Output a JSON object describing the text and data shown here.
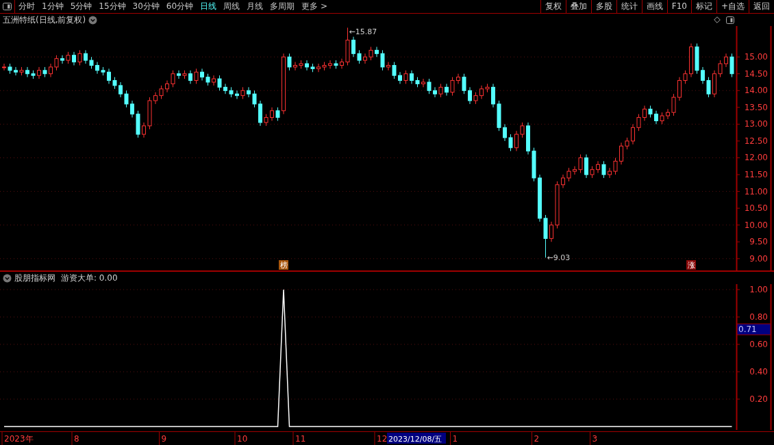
{
  "toolbar": {
    "periods": [
      {
        "label": "分时",
        "selected": false
      },
      {
        "label": "1分钟",
        "selected": false
      },
      {
        "label": "5分钟",
        "selected": false
      },
      {
        "label": "15分钟",
        "selected": false
      },
      {
        "label": "30分钟",
        "selected": false
      },
      {
        "label": "60分钟",
        "selected": false
      },
      {
        "label": "日线",
        "selected": true
      },
      {
        "label": "周线",
        "selected": false
      },
      {
        "label": "月线",
        "selected": false
      },
      {
        "label": "多周期",
        "selected": false
      },
      {
        "label": "更多 >",
        "selected": false
      }
    ],
    "buttons": [
      "复权",
      "叠加",
      "多股",
      "统计",
      "画线",
      "F10",
      "标记",
      "+自选",
      "返回"
    ]
  },
  "price_panel": {
    "title": "五洲特纸(日线,前复权)",
    "chart_data": {
      "type": "candlestick",
      "ylim": [
        8.65,
        15.92
      ],
      "grid": true,
      "ohlc": [
        [
          14.7,
          14.8,
          14.6,
          14.7
        ],
        [
          14.7,
          14.8,
          14.5,
          14.6
        ],
        [
          14.6,
          14.7,
          14.45,
          14.55
        ],
        [
          14.55,
          14.7,
          14.45,
          14.6
        ],
        [
          14.6,
          14.7,
          14.4,
          14.5
        ],
        [
          14.5,
          14.6,
          14.35,
          14.45
        ],
        [
          14.45,
          14.7,
          14.35,
          14.6
        ],
        [
          14.6,
          14.7,
          14.4,
          14.5
        ],
        [
          14.5,
          14.8,
          14.4,
          14.7
        ],
        [
          14.7,
          15.05,
          14.6,
          14.95
        ],
        [
          14.95,
          15.05,
          14.8,
          14.9
        ],
        [
          14.9,
          15.15,
          14.8,
          15.05
        ],
        [
          15.05,
          15.15,
          14.75,
          14.85
        ],
        [
          14.85,
          15.2,
          14.75,
          15.1
        ],
        [
          15.1,
          15.2,
          14.8,
          14.9
        ],
        [
          14.9,
          15.0,
          14.65,
          14.75
        ],
        [
          14.75,
          14.85,
          14.5,
          14.6
        ],
        [
          14.6,
          14.7,
          14.45,
          14.55
        ],
        [
          14.55,
          14.65,
          14.2,
          14.3
        ],
        [
          14.3,
          14.4,
          14.05,
          14.15
        ],
        [
          14.15,
          14.25,
          13.8,
          13.9
        ],
        [
          13.9,
          14.0,
          13.5,
          13.6
        ],
        [
          13.6,
          13.7,
          13.2,
          13.3
        ],
        [
          13.3,
          13.4,
          12.6,
          12.7
        ],
        [
          12.7,
          13.05,
          12.6,
          12.95
        ],
        [
          12.95,
          13.8,
          12.85,
          13.7
        ],
        [
          13.7,
          13.95,
          13.6,
          13.85
        ],
        [
          13.85,
          14.15,
          13.75,
          14.05
        ],
        [
          14.05,
          14.3,
          13.95,
          14.2
        ],
        [
          14.2,
          14.6,
          14.1,
          14.5
        ],
        [
          14.5,
          14.6,
          14.35,
          14.45
        ],
        [
          14.45,
          14.6,
          14.35,
          14.5
        ],
        [
          14.5,
          14.6,
          14.2,
          14.3
        ],
        [
          14.3,
          14.65,
          14.2,
          14.55
        ],
        [
          14.55,
          14.65,
          14.3,
          14.4
        ],
        [
          14.4,
          14.5,
          14.15,
          14.25
        ],
        [
          14.25,
          14.45,
          14.15,
          14.35
        ],
        [
          14.35,
          14.45,
          14.0,
          14.1
        ],
        [
          14.1,
          14.2,
          13.9,
          14.0
        ],
        [
          14.0,
          14.1,
          13.8,
          13.9
        ],
        [
          13.9,
          14.0,
          13.75,
          13.85
        ],
        [
          13.85,
          14.1,
          13.75,
          14.0
        ],
        [
          14.0,
          14.1,
          13.8,
          13.9
        ],
        [
          13.9,
          14.0,
          13.5,
          13.6
        ],
        [
          13.6,
          13.7,
          12.95,
          13.05
        ],
        [
          13.05,
          13.3,
          12.95,
          13.2
        ],
        [
          13.2,
          13.5,
          13.1,
          13.4
        ],
        [
          13.4,
          13.5,
          13.1,
          13.2
        ],
        [
          13.4,
          15.1,
          13.3,
          15.0
        ],
        [
          15.0,
          15.1,
          14.6,
          14.7
        ],
        [
          14.7,
          14.85,
          14.6,
          14.75
        ],
        [
          14.75,
          14.9,
          14.65,
          14.8
        ],
        [
          14.8,
          14.9,
          14.6,
          14.7
        ],
        [
          14.7,
          14.8,
          14.55,
          14.65
        ],
        [
          14.65,
          14.8,
          14.55,
          14.7
        ],
        [
          14.7,
          14.85,
          14.6,
          14.75
        ],
        [
          14.75,
          14.9,
          14.65,
          14.8
        ],
        [
          14.8,
          14.9,
          14.65,
          14.75
        ],
        [
          14.75,
          14.95,
          14.65,
          14.85
        ],
        [
          14.85,
          15.87,
          14.75,
          15.5
        ],
        [
          15.5,
          15.6,
          15.0,
          15.1
        ],
        [
          15.1,
          15.2,
          14.8,
          14.9
        ],
        [
          14.9,
          15.1,
          14.8,
          15.0
        ],
        [
          15.0,
          15.3,
          14.9,
          15.2
        ],
        [
          15.2,
          15.3,
          15.0,
          15.1
        ],
        [
          15.1,
          15.2,
          14.6,
          14.7
        ],
        [
          14.7,
          14.85,
          14.6,
          14.75
        ],
        [
          14.75,
          14.85,
          14.35,
          14.45
        ],
        [
          14.45,
          14.55,
          14.2,
          14.3
        ],
        [
          14.3,
          14.6,
          14.2,
          14.5
        ],
        [
          14.5,
          14.6,
          14.2,
          14.3
        ],
        [
          14.3,
          14.4,
          14.1,
          14.2
        ],
        [
          14.2,
          14.35,
          14.1,
          14.25
        ],
        [
          14.25,
          14.35,
          13.9,
          14.0
        ],
        [
          14.0,
          14.1,
          13.8,
          13.9
        ],
        [
          13.9,
          14.2,
          13.8,
          14.1
        ],
        [
          14.1,
          14.2,
          13.85,
          13.95
        ],
        [
          13.95,
          14.4,
          13.85,
          14.3
        ],
        [
          14.3,
          14.5,
          14.2,
          14.4
        ],
        [
          14.4,
          14.5,
          13.9,
          14.0
        ],
        [
          14.0,
          14.1,
          13.6,
          13.7
        ],
        [
          13.7,
          13.95,
          13.6,
          13.85
        ],
        [
          13.85,
          14.15,
          13.75,
          14.05
        ],
        [
          14.05,
          14.2,
          13.95,
          14.1
        ],
        [
          14.1,
          14.2,
          13.5,
          13.6
        ],
        [
          13.6,
          13.7,
          12.8,
          12.9
        ],
        [
          12.9,
          13.0,
          12.5,
          12.6
        ],
        [
          12.6,
          12.7,
          12.2,
          12.3
        ],
        [
          12.3,
          12.8,
          12.2,
          12.7
        ],
        [
          12.7,
          13.05,
          12.6,
          12.95
        ],
        [
          12.95,
          13.05,
          12.1,
          12.2
        ],
        [
          12.2,
          12.3,
          11.3,
          11.4
        ],
        [
          11.4,
          11.5,
          10.1,
          10.2
        ],
        [
          10.2,
          10.3,
          9.03,
          9.6
        ],
        [
          9.6,
          10.1,
          9.5,
          10.0
        ],
        [
          10.0,
          11.3,
          9.9,
          11.2
        ],
        [
          11.2,
          11.5,
          11.1,
          11.4
        ],
        [
          11.4,
          11.7,
          11.3,
          11.6
        ],
        [
          11.6,
          11.75,
          11.5,
          11.65
        ],
        [
          11.65,
          12.1,
          11.55,
          12.0
        ],
        [
          12.0,
          12.1,
          11.4,
          11.5
        ],
        [
          11.5,
          11.75,
          11.4,
          11.65
        ],
        [
          11.65,
          11.9,
          11.55,
          11.8
        ],
        [
          11.8,
          11.9,
          11.4,
          11.5
        ],
        [
          11.5,
          11.7,
          11.4,
          11.6
        ],
        [
          11.6,
          12.0,
          11.5,
          11.9
        ],
        [
          11.9,
          12.45,
          11.8,
          12.35
        ],
        [
          12.35,
          12.6,
          12.25,
          12.5
        ],
        [
          12.5,
          13.0,
          12.4,
          12.9
        ],
        [
          12.9,
          13.3,
          12.8,
          13.2
        ],
        [
          13.2,
          13.55,
          13.1,
          13.45
        ],
        [
          13.45,
          13.55,
          13.2,
          13.3
        ],
        [
          13.3,
          13.4,
          13.0,
          13.1
        ],
        [
          13.1,
          13.35,
          13.0,
          13.25
        ],
        [
          13.25,
          13.45,
          13.15,
          13.35
        ],
        [
          13.35,
          13.9,
          13.25,
          13.8
        ],
        [
          13.8,
          14.4,
          13.7,
          14.3
        ],
        [
          14.3,
          14.6,
          14.2,
          14.5
        ],
        [
          14.5,
          15.4,
          14.4,
          15.3
        ],
        [
          15.3,
          15.4,
          14.5,
          14.6
        ],
        [
          14.6,
          14.7,
          14.2,
          14.3
        ],
        [
          14.3,
          14.4,
          13.8,
          13.9
        ],
        [
          13.9,
          14.6,
          13.8,
          14.5
        ],
        [
          14.5,
          14.9,
          14.4,
          14.8
        ],
        [
          14.8,
          15.1,
          14.7,
          15.0
        ],
        [
          15.0,
          15.1,
          14.4,
          14.5
        ]
      ],
      "yticks": [
        {
          "value": 15,
          "label": "15.00"
        },
        {
          "value": 14.5,
          "label": "14.50"
        },
        {
          "value": 14,
          "label": "14.00"
        },
        {
          "value": 13.5,
          "label": "13.50"
        },
        {
          "value": 13,
          "label": "13.00"
        },
        {
          "value": 12.5,
          "label": "12.50"
        },
        {
          "value": 12,
          "label": "12.00"
        },
        {
          "value": 11.5,
          "label": "11.50"
        },
        {
          "value": 11,
          "label": "11.00"
        },
        {
          "value": 10.5,
          "label": "10.50"
        },
        {
          "value": 10,
          "label": "10.00"
        },
        {
          "value": 9.5,
          "label": "9.50"
        },
        {
          "value": 9,
          "label": "9.00"
        }
      ],
      "annotations": [
        "←15.87",
        "←9.03"
      ]
    },
    "event_tags": [
      {
        "label": "榜",
        "color": "#a8560c"
      },
      {
        "label": "涨",
        "color": "#8b0a0a"
      }
    ]
  },
  "indicator_panel": {
    "source": "股朋指标网",
    "legend": "游资大单: 0.00",
    "chart_data": {
      "type": "line",
      "ylim": [
        -0.025,
        1.04
      ],
      "grid": true,
      "series": [
        {
          "color": "#ffffff",
          "values": [
            0,
            0,
            0,
            0,
            0,
            0,
            0,
            0,
            0,
            0,
            0,
            0,
            0,
            0,
            0,
            0,
            0,
            0,
            0,
            0,
            0,
            0,
            0,
            0,
            0,
            0,
            0,
            0,
            0,
            0,
            0,
            0,
            0,
            0,
            0,
            0,
            0,
            0,
            0,
            0,
            0,
            0,
            0,
            0,
            0,
            0,
            0,
            0,
            1,
            0,
            0,
            0,
            0,
            0,
            0,
            0,
            0,
            0,
            0,
            0,
            0,
            0,
            0,
            0,
            0,
            0,
            0,
            0,
            0,
            0,
            0,
            0,
            0,
            0,
            0,
            0,
            0,
            0,
            0,
            0,
            0,
            0,
            0,
            0,
            0,
            0,
            0,
            0,
            0,
            0,
            0,
            0,
            0,
            0,
            0,
            0,
            0,
            0,
            0,
            0,
            0,
            0,
            0,
            0,
            0,
            0,
            0,
            0,
            0,
            0,
            0,
            0,
            0,
            0,
            0,
            0,
            0,
            0,
            0,
            0,
            0,
            0,
            0,
            0,
            0,
            0
          ]
        }
      ],
      "yticks": [
        {
          "value": 1,
          "label": "1.00"
        },
        {
          "value": 0.8,
          "label": "0.80"
        },
        {
          "value": 0.6,
          "label": "0.60"
        },
        {
          "value": 0.4,
          "label": "0.40"
        },
        {
          "value": 0.2,
          "label": "0.20"
        }
      ]
    },
    "current_value": "0.71"
  },
  "time_axis": [
    "2023年",
    "8",
    "9",
    "10",
    "11",
    "12",
    "1",
    "2",
    "3"
  ],
  "cursor_date": "2023/12/08/五"
}
